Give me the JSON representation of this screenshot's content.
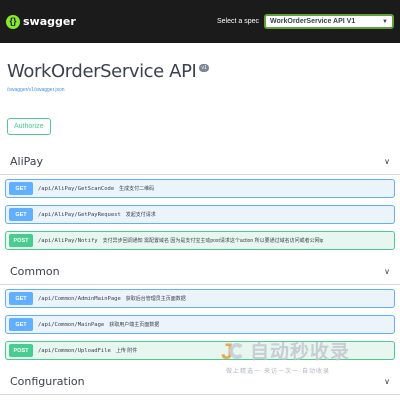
{
  "topbar": {
    "logo_glyph": "{}",
    "logo_text": "swagger",
    "spec_label": "Select a spec",
    "spec_value": "WorkOrderService API V1"
  },
  "info": {
    "title": "WorkOrderService API",
    "version": "v1",
    "url": "/swagger/v1/swagger.json"
  },
  "authorize_label": "Authorize",
  "tags": [
    {
      "name": "AliPay",
      "operations": [
        {
          "method": "GET",
          "path": "/api/AliPay/GetScanCode",
          "summary": "生成支付二维码"
        },
        {
          "method": "GET",
          "path": "/api/AliPay/GetPayRequest",
          "summary": "发起支付请求"
        },
        {
          "method": "POST",
          "path": "/api/AliPay/Notify",
          "summary": "支付异步回调通知 需配置域名 因为是支付宝主动post请求这个action 所以要通过域名访问或者公网ip"
        }
      ]
    },
    {
      "name": "Common",
      "operations": [
        {
          "method": "GET",
          "path": "/api/Common/AdminMainPage",
          "summary": "获取后台管理员主页面数据"
        },
        {
          "method": "GET",
          "path": "/api/Common/MainPage",
          "summary": "获取用户端主页面数据"
        },
        {
          "method": "POST",
          "path": "/api/Common/UploadFile",
          "summary": "上传 附件"
        }
      ]
    },
    {
      "name": "Configuration",
      "operations": []
    }
  ],
  "watermark": {
    "main": "自动秒收录",
    "sub": "做上精选一·来访一次一·自动收录"
  },
  "colors": {
    "get": "#61affe",
    "post": "#49cc90",
    "topbar": "#1b1b1b"
  }
}
